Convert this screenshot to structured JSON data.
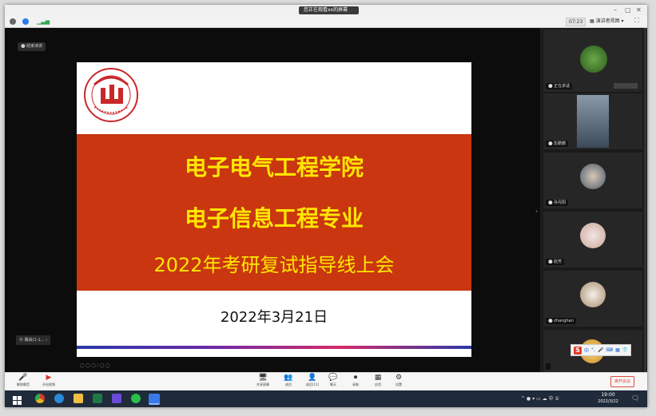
{
  "window": {
    "title": "您正在观看xx的屏幕 ",
    "title_badge": "",
    "controls": {
      "minimize": "–",
      "maximize": "▢",
      "close": "✕"
    }
  },
  "topbar": {
    "signal_icon": "signal-bars-icon",
    "timer": "07:23",
    "view_label": "▦ 演讲者视图 ▾",
    "fullscreen_icon": "⛶"
  },
  "stage": {
    "speaker_tag": "⬤ 结束演讲",
    "self_view_label": "⦿ 路由(1-1...  ‹",
    "nav_hint": "◯ ◯ ◯ / ◯ ◯",
    "collapse_icon": "›"
  },
  "slide": {
    "line1": "电子电气工程学院",
    "line2": "电子信息工程专业",
    "line3": "2022年考研复试指导线上会",
    "date": "2022年3月21日",
    "brand_color": "#c9360f",
    "headline_color": "#ffe600"
  },
  "participants": [
    {
      "name": "⬤ 正在讲话",
      "avatar": "plant-photo"
    },
    {
      "name": "⬤ 彭鹏鹏",
      "avatar": "person-photo"
    },
    {
      "name": "⬤ 孙丹阳",
      "avatar": "person-photo"
    },
    {
      "name": "⬤ 赵芳",
      "avatar": "woman-photo"
    },
    {
      "name": "⬤ zhanghan",
      "avatar": "coffee-photo"
    },
    {
      "name": "",
      "avatar": "cartoon-photo"
    }
  ],
  "ime": {
    "logo": "S",
    "items": [
      "中",
      "°,",
      "🎤",
      "⌨",
      "▦",
      "👕"
    ]
  },
  "toolbar": {
    "left": [
      {
        "icon": "🎤",
        "label": "解除静音"
      },
      {
        "icon": "▶",
        "label": "开启视频"
      }
    ],
    "center": [
      {
        "icon": "🖥",
        "label": "共享屏幕"
      },
      {
        "icon": "👥",
        "label": "成员"
      },
      {
        "icon": "👤",
        "label": "成员(11)"
      },
      {
        "icon": "💬",
        "label": "聊天"
      },
      {
        "icon": "⏺",
        "label": "录制"
      },
      {
        "icon": "▦",
        "label": "应用"
      },
      {
        "icon": "⚙",
        "label": "设置"
      }
    ],
    "end_label": "离开会议"
  },
  "taskbar": {
    "apps": [
      {
        "name": "windows",
        "color": "#ffffff"
      },
      {
        "name": "chrome",
        "color": "#e8b020"
      },
      {
        "name": "edge",
        "color": "#2a8ad8"
      },
      {
        "name": "explorer",
        "color": "#f0c040"
      },
      {
        "name": "excel",
        "color": "#1e7a44"
      },
      {
        "name": "teams",
        "color": "#6a4ad8"
      },
      {
        "name": "wechat",
        "color": "#2ac04a"
      },
      {
        "name": "meeting",
        "color": "#3a7ae8"
      }
    ],
    "tray": "^ ● ▾ ▭ ☁ 中 ⑤",
    "time": "19:00",
    "date": "2022/3/22",
    "notif_icon": "🗨"
  }
}
